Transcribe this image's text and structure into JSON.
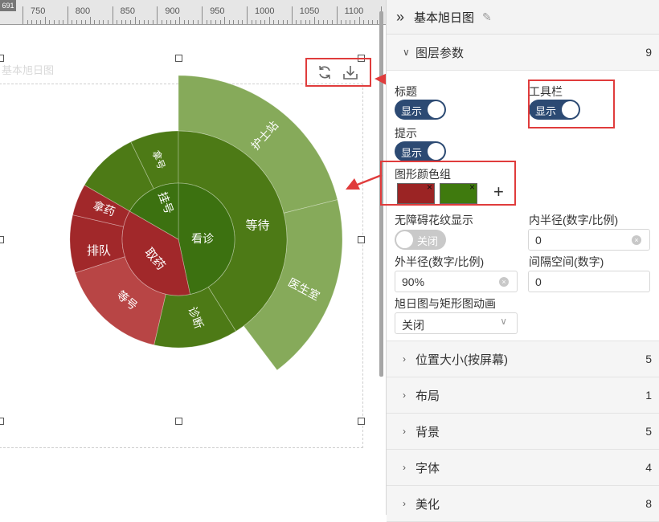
{
  "ruler": {
    "corner_label": "691",
    "labels": [
      "750",
      "800",
      "850",
      "900",
      "950",
      "1000",
      "1050",
      "1100"
    ]
  },
  "chart": {
    "title": "基本旭日图",
    "toolbar_icons": [
      "refresh-icon",
      "download-icon"
    ],
    "colors": {
      "red": "#a1282a",
      "red_light": "#b84545",
      "green": "#4d7a16",
      "green_mid": "#6a9a36",
      "green_light": "#86aa5a",
      "center": "#3c7110"
    }
  },
  "chart_data": {
    "type": "sunburst",
    "title": "基本旭日图",
    "rings": [
      {
        "level": 1,
        "items": [
          "看诊",
          "取药"
        ]
      },
      {
        "level": 2,
        "items": [
          {
            "name": "等待",
            "parent": "看诊"
          },
          {
            "name": "诊断",
            "parent": "看诊"
          },
          {
            "name": "挂号",
            "parent": "看诊"
          },
          {
            "name": "排队",
            "parent": "取药"
          },
          {
            "name": "拿药",
            "parent": "取药"
          },
          {
            "name": "等号",
            "parent": "取药"
          }
        ]
      },
      {
        "level": 3,
        "items": [
          {
            "name": "护士站",
            "parent": "等待"
          },
          {
            "name": "医生室",
            "parent": "等待"
          },
          {
            "name": "排队",
            "parent": "挂号"
          },
          {
            "name": "拿号",
            "parent": "挂号"
          }
        ]
      }
    ]
  },
  "panel": {
    "title": "基本旭日图",
    "layer_section": {
      "label": "图层参数",
      "count": "9"
    },
    "fields": {
      "title_label": "标题",
      "title_toggle": "显示",
      "toolbar_label": "工具栏",
      "toolbar_toggle": "显示",
      "tooltip_label": "提示",
      "tooltip_toggle": "显示",
      "color_group_label": "图形颜色组",
      "color_group": [
        "#9b2424",
        "#3f7a0e"
      ],
      "accessible_label": "无障碍花纹显示",
      "accessible_toggle": "关闭",
      "inner_radius_label": "内半径(数字/比例)",
      "inner_radius_value": "0",
      "outer_radius_label": "外半径(数字/比例)",
      "outer_radius_value": "90%",
      "gap_label": "间隔空间(数字)",
      "gap_value": "0",
      "animation_label": "旭日图与矩形图动画",
      "animation_value": "关闭"
    },
    "sections": [
      {
        "label": "位置大小(按屏幕)",
        "count": "5"
      },
      {
        "label": "布局",
        "count": "1"
      },
      {
        "label": "背景",
        "count": "5"
      },
      {
        "label": "字体",
        "count": "4"
      },
      {
        "label": "美化",
        "count": "8"
      }
    ]
  }
}
